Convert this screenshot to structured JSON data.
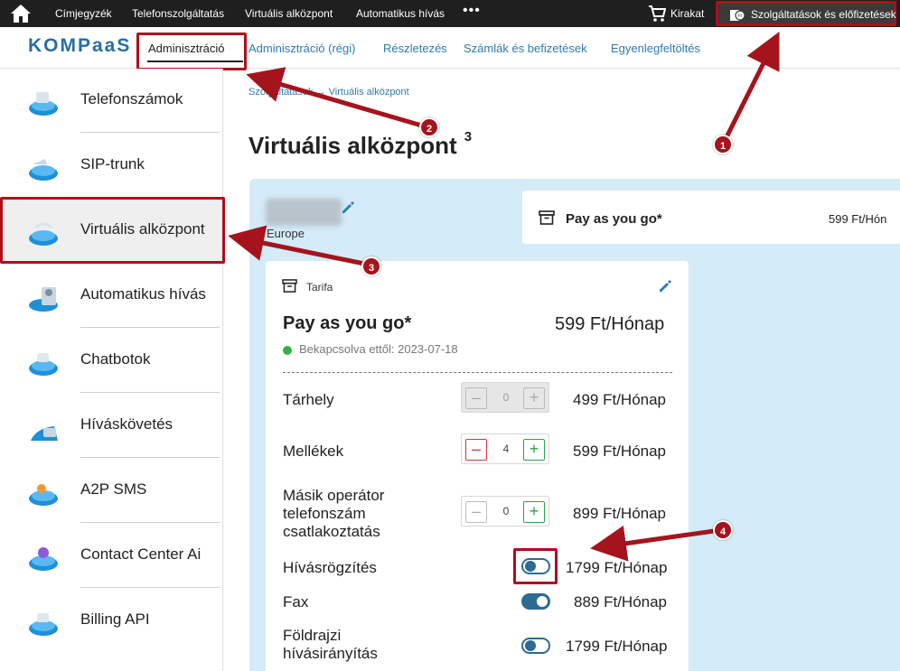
{
  "topbar": {
    "nav": [
      "Címjegyzék",
      "Telefonszolgáltatás",
      "Virtuális alközpont",
      "Automatikus hívás"
    ],
    "more": "•••",
    "cart_label": "Kirakat",
    "subscriptions_label": "Szolgáltatások és előfizetések"
  },
  "subnav": {
    "logo": "KOMPaaS",
    "tabs": [
      "Adminisztráció",
      "Adminisztráció (régi)",
      "Részletezés",
      "Számlák és befizetések",
      "Egyenlegfeltöltés"
    ]
  },
  "sidebar": {
    "items": [
      "Telefonszámok",
      "SIP-trunk",
      "Virtuális alközpont",
      "Automatikus hívás",
      "Chatbotok",
      "Híváskövetés",
      "A2P SMS",
      "Contact Center Ai",
      "Billing API"
    ]
  },
  "main": {
    "breadcrumb": "Szolgáltatások → Virtuális alközpont",
    "title": "Virtuális alközpont",
    "title_count": "3",
    "region": "Europe",
    "plan_strip": {
      "name": "Pay as you go*",
      "price": "599 Ft/Hón"
    },
    "card": {
      "tarifa_label": "Tarifa",
      "plan_name": "Pay as you go*",
      "plan_price": "599 Ft/Hónap",
      "status": "Bekapcsolva ettől: 2023-07-18",
      "rows": [
        {
          "label": "Tárhely",
          "value": "0",
          "price": "499 Ft/Hónap"
        },
        {
          "label": "Mellékek",
          "value": "4",
          "price": "599 Ft/Hónap"
        },
        {
          "label": "Másik operátor telefonszám csatlakoztatás",
          "value": "0",
          "price": "899 Ft/Hónap"
        },
        {
          "label": "Hívásrögzítés",
          "price": "1799 Ft/Hónap",
          "enabled": false
        },
        {
          "label": "Fax",
          "price": "889 Ft/Hónap",
          "enabled": true
        },
        {
          "label": "Földrajzi hívásirányítás",
          "price": "1799 Ft/Hónap",
          "enabled": false
        }
      ]
    }
  },
  "annotations": [
    "1",
    "2",
    "3",
    "4"
  ],
  "colors": {
    "highlight": "#b20d1c",
    "link": "#2d7bb0",
    "panel": "#d4ebf8",
    "toggle": "#2d6a94"
  }
}
